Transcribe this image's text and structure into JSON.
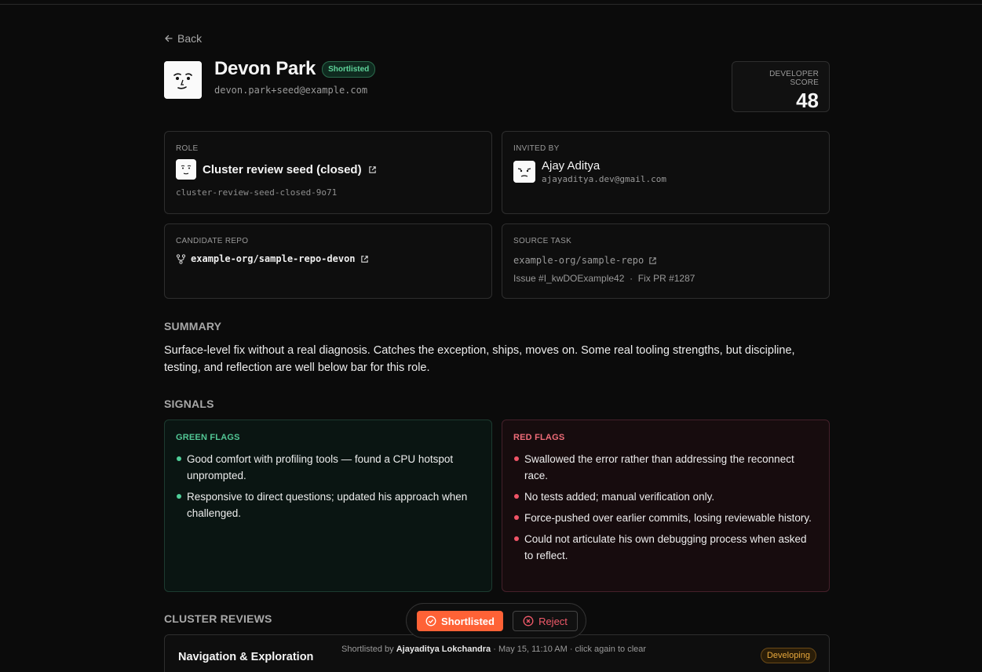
{
  "nav": {
    "back_label": "Back"
  },
  "candidate": {
    "name": "Devon Park",
    "status": "Shortlisted",
    "email": "devon.park+seed@example.com"
  },
  "score": {
    "label": "DEVELOPER SCORE",
    "value": "48"
  },
  "role": {
    "label": "ROLE",
    "title": "Cluster review seed (closed)",
    "slug": "cluster-review-seed-closed-9o71"
  },
  "invited_by": {
    "label": "INVITED BY",
    "name": "Ajay Aditya",
    "email": "ajayaditya.dev@gmail.com"
  },
  "candidate_repo": {
    "label": "CANDIDATE REPO",
    "name": "example-org/sample-repo-devon"
  },
  "source_task": {
    "label": "SOURCE TASK",
    "repo": "example-org/sample-repo",
    "issue": "Issue #I_kwDOExample42",
    "separator": "·",
    "pr": "Fix PR #1287"
  },
  "summary": {
    "heading": "SUMMARY",
    "text": "Surface-level fix without a real diagnosis. Catches the exception, ships, moves on. Some real tooling strengths, but discipline, testing, and reflection are well below bar for this role."
  },
  "signals": {
    "heading": "SIGNALS",
    "green": {
      "label": "GREEN FLAGS",
      "items": [
        "Good comfort with profiling tools — found a CPU hotspot unprompted.",
        "Responsive to direct questions; updated his approach when challenged."
      ]
    },
    "red": {
      "label": "RED FLAGS",
      "items": [
        "Swallowed the error rather than addressing the reconnect race.",
        "No tests added; manual verification only.",
        "Force-pushed over earlier commits, losing reviewable history.",
        "Could not articulate his own debugging process when asked to reflect."
      ]
    }
  },
  "cluster_reviews": {
    "heading": "CLUSTER REVIEWS",
    "items": [
      {
        "name": "Navigation & Exploration",
        "badge": "Developing"
      }
    ]
  },
  "actions": {
    "shortlist_label": "Shortlisted",
    "reject_label": "Reject",
    "note_prefix": "Shortlisted by",
    "note_user": "Ajayaditya Lokchandra",
    "note_suffix": "· May 15, 11:10 AM · click again to clear"
  },
  "colors": {
    "accent": "#ff6236",
    "green": "#4fcf99",
    "red": "#f05467",
    "amber": "#e7a83c"
  }
}
